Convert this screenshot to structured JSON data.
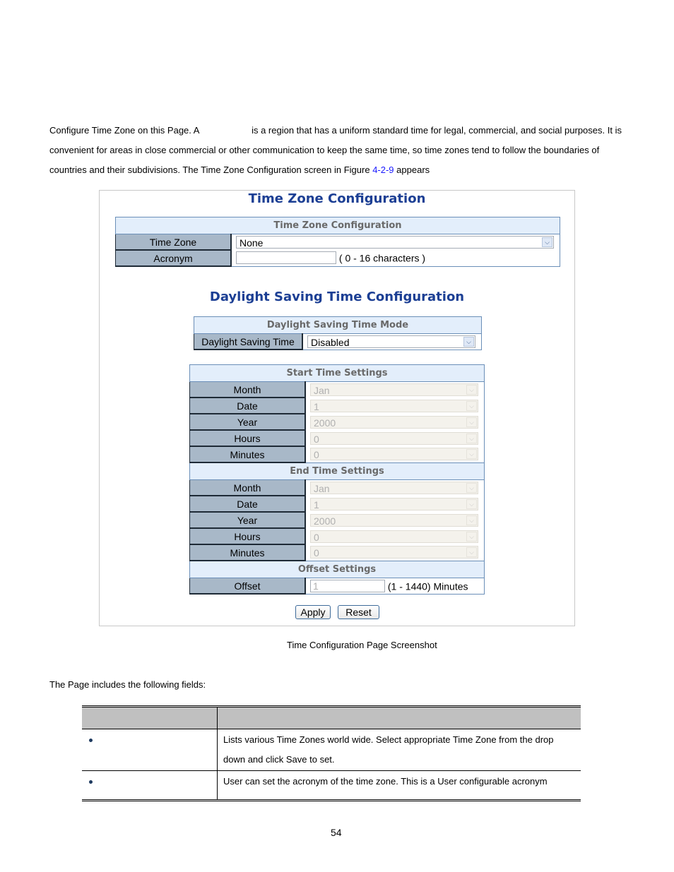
{
  "intro": {
    "part1": "Configure Time Zone on this Page. A",
    "part2": "is a region that has a uniform standard time for legal, commercial, and social purposes. It is convenient for areas in close commercial or other communication to keep the same time, so time zones tend to follow the boundaries of countries and their subdivisions. The Time Zone Configuration screen in Figure",
    "figure_ref": "4-2-9",
    "part3": "appears"
  },
  "screenshot": {
    "title": "Time Zone Configuration",
    "tz_section": {
      "header": "Time Zone Configuration",
      "time_zone_label": "Time Zone",
      "time_zone_value": "None",
      "acronym_label": "Acronym",
      "acronym_value": "",
      "acronym_hint": "( 0 - 16 characters )"
    },
    "dst_title": "Daylight Saving Time Configuration",
    "dst_mode": {
      "header": "Daylight Saving Time Mode",
      "label": "Daylight Saving Time",
      "value": "Disabled"
    },
    "start": {
      "header": "Start Time Settings",
      "rows": [
        {
          "label": "Month",
          "value": "Jan"
        },
        {
          "label": "Date",
          "value": "1"
        },
        {
          "label": "Year",
          "value": "2000"
        },
        {
          "label": "Hours",
          "value": "0"
        },
        {
          "label": "Minutes",
          "value": "0"
        }
      ]
    },
    "end": {
      "header": "End Time Settings",
      "rows": [
        {
          "label": "Month",
          "value": "Jan"
        },
        {
          "label": "Date",
          "value": "1"
        },
        {
          "label": "Year",
          "value": "2000"
        },
        {
          "label": "Hours",
          "value": "0"
        },
        {
          "label": "Minutes",
          "value": "0"
        }
      ]
    },
    "offset": {
      "header": "Offset Settings",
      "label": "Offset",
      "value": "1",
      "hint": "(1 - 1440) Minutes"
    },
    "buttons": {
      "apply": "Apply",
      "reset": "Reset"
    }
  },
  "caption": "Time Configuration Page Screenshot",
  "fields_intro": "The Page includes the following fields:",
  "fields_table": {
    "headers": [
      "",
      ""
    ],
    "rows": [
      {
        "object": "",
        "description": "Lists various Time Zones world wide. Select appropriate Time Zone from the drop down and click Save to set."
      },
      {
        "object": "",
        "description": "User can set the acronym of the time zone. This is a User configurable acronym"
      }
    ]
  },
  "page_number": "54"
}
